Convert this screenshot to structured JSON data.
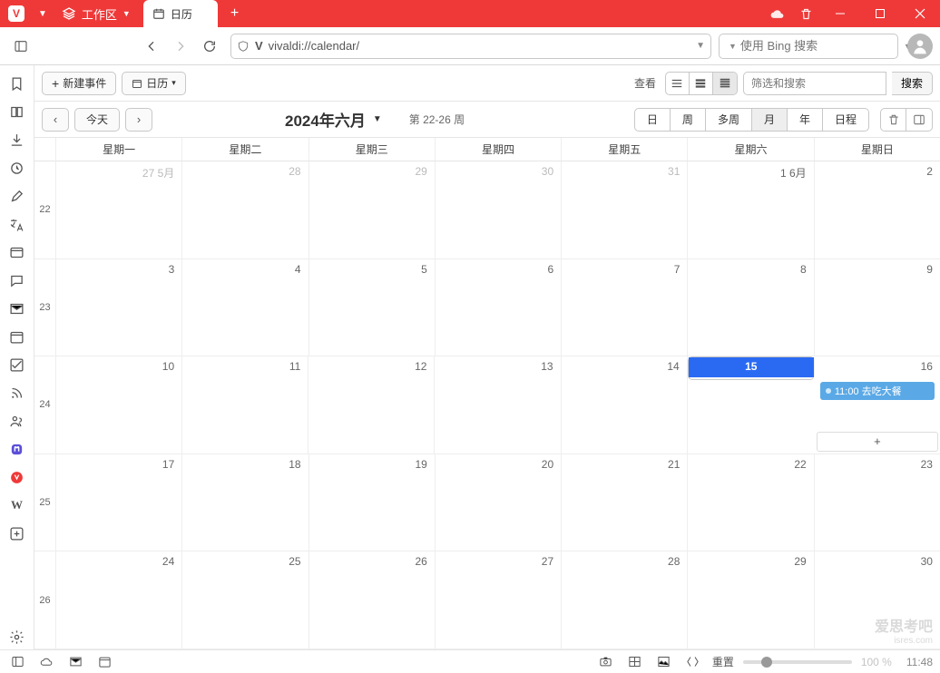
{
  "titlebar": {
    "workspace_label": "工作区",
    "tab_label": "日历"
  },
  "addressbar": {
    "url": "vivaldi://calendar/",
    "search_placeholder": "使用 Bing 搜索"
  },
  "toolbar": {
    "new_event": "新建事件",
    "calendar_label": "日历",
    "view_label": "查看",
    "filter_placeholder": "筛选和搜索",
    "search_label": "搜索"
  },
  "nav": {
    "today": "今天",
    "month_title": "2024年六月",
    "week_range": "第 22-26 周",
    "ranges": [
      "日",
      "周",
      "多周",
      "月",
      "年",
      "日程"
    ]
  },
  "calendar": {
    "weekdays": [
      "星期一",
      "星期二",
      "星期三",
      "星期四",
      "星期五",
      "星期六",
      "星期日"
    ],
    "week_numbers": [
      "22",
      "23",
      "24",
      "25",
      "26"
    ],
    "rows": [
      [
        {
          "label": "27 5月",
          "other": true
        },
        {
          "label": "28",
          "other": true
        },
        {
          "label": "29",
          "other": true
        },
        {
          "label": "30",
          "other": true
        },
        {
          "label": "31",
          "other": true
        },
        {
          "label": "1 6月"
        },
        {
          "label": "2"
        }
      ],
      [
        {
          "label": "3"
        },
        {
          "label": "4"
        },
        {
          "label": "5"
        },
        {
          "label": "6"
        },
        {
          "label": "7"
        },
        {
          "label": "8"
        },
        {
          "label": "9"
        }
      ],
      [
        {
          "label": "10"
        },
        {
          "label": "11"
        },
        {
          "label": "12"
        },
        {
          "label": "13"
        },
        {
          "label": "14"
        },
        {
          "label": "15",
          "today": true
        },
        {
          "label": "16",
          "event": {
            "time": "11:00",
            "title": "去吃大餐"
          },
          "add": true
        }
      ],
      [
        {
          "label": "17"
        },
        {
          "label": "18"
        },
        {
          "label": "19"
        },
        {
          "label": "20"
        },
        {
          "label": "21"
        },
        {
          "label": "22"
        },
        {
          "label": "23"
        }
      ],
      [
        {
          "label": "24"
        },
        {
          "label": "25"
        },
        {
          "label": "26"
        },
        {
          "label": "27"
        },
        {
          "label": "28"
        },
        {
          "label": "29"
        },
        {
          "label": "30"
        }
      ]
    ]
  },
  "status": {
    "reset": "重置",
    "zoom": "100 %",
    "time": "11:48"
  },
  "watermark": {
    "line1": "爱思考吧",
    "line2": "isres.com"
  }
}
